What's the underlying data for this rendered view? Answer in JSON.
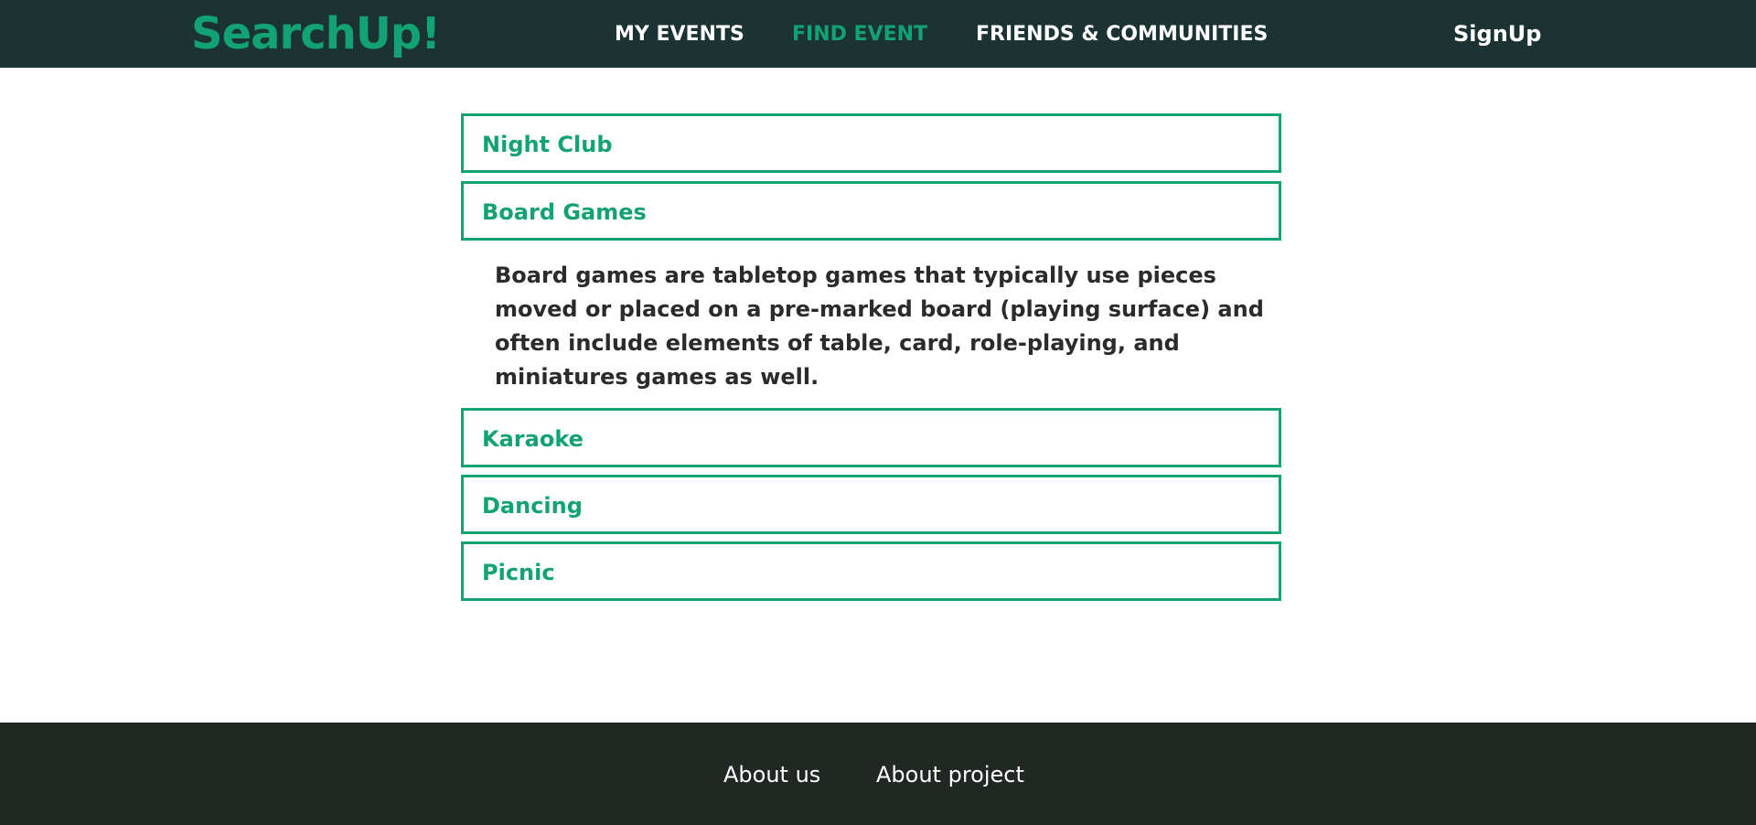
{
  "header": {
    "logo": "SearchUp!",
    "nav": {
      "my_events": "MY EVENTS",
      "find_event": "FIND EVENT",
      "friends": "FRIENDS & COMMUNITIES"
    },
    "signup": "SignUp"
  },
  "categories": [
    {
      "label": "Night Club"
    },
    {
      "label": "Board Games",
      "expanded": true,
      "description": "Board games are tabletop games that typically use pieces moved or placed on a pre-marked board (playing surface) and often include elements of table, card, role-playing, and miniatures games as well."
    },
    {
      "label": "Karaoke"
    },
    {
      "label": "Dancing"
    },
    {
      "label": "Picnic"
    }
  ],
  "footer": {
    "about_us": "About us",
    "about_project": "About project"
  },
  "colors": {
    "accent": "#13a273",
    "header_bg": "#1b3333",
    "footer_bg": "#212823",
    "text_dark": "#2b2b2b"
  }
}
